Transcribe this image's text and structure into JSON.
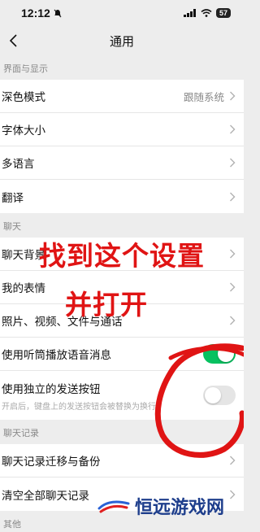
{
  "status": {
    "time": "12:12",
    "battery": "57"
  },
  "nav": {
    "title": "通用"
  },
  "sections": {
    "display": {
      "header": "界面与显示",
      "dark_mode": {
        "label": "深色模式",
        "value": "跟随系统"
      },
      "font_size": {
        "label": "字体大小"
      },
      "language": {
        "label": "多语言"
      },
      "translate": {
        "label": "翻译"
      }
    },
    "chat": {
      "header": "聊天",
      "background": {
        "label": "聊天背景"
      },
      "stickers": {
        "label": "我的表情"
      },
      "media": {
        "label": "照片、视频、文件与通话"
      },
      "earpiece": {
        "label": "使用听筒播放语音消息",
        "enabled": true
      },
      "send_button": {
        "label": "使用独立的发送按钮",
        "sub": "开启后，键盘上的发送按钮会被替换为换行",
        "enabled": false
      }
    },
    "history": {
      "header": "聊天记录",
      "migrate": {
        "label": "聊天记录迁移与备份"
      },
      "clear": {
        "label": "清空全部聊天记录"
      }
    },
    "other": {
      "header": "其他"
    }
  },
  "overlay": {
    "line1": "找到这个设置",
    "line2": "并打开"
  },
  "watermark": {
    "text": "恒远游戏网"
  },
  "colors": {
    "accent": "#07c160",
    "annotation": "#e01414",
    "watermark": "#1e3e8c"
  }
}
